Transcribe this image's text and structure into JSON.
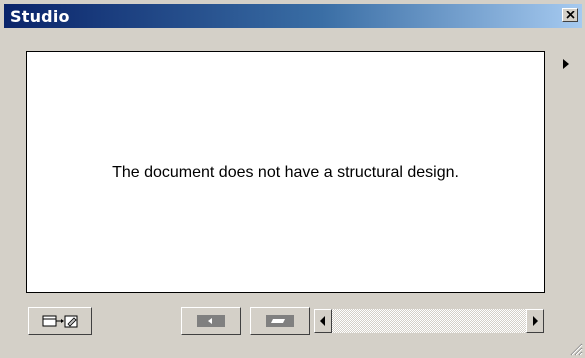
{
  "window": {
    "title": "Studio"
  },
  "canvas": {
    "message": "The document does not have a structural design."
  }
}
